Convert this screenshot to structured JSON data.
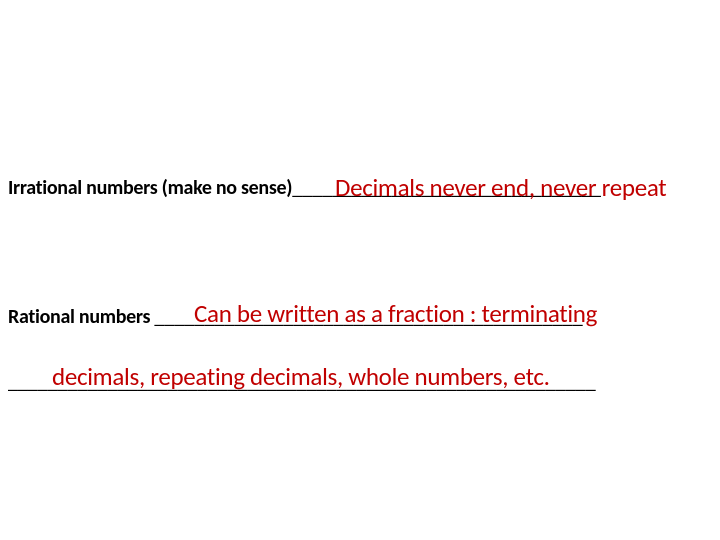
{
  "irrational": {
    "prompt": "Irrational numbers (make no sense)",
    "blank": "_______________________________",
    "answer": "Decimals never end, never repeat"
  },
  "rational": {
    "prompt": "Rational numbers ",
    "blank": "___________________________________________",
    "answer": "Can be written as a fraction : terminating "
  },
  "continuation": {
    "blank": "___________________________________________________________",
    "answer": "decimals, repeating decimals, whole numbers, etc."
  }
}
